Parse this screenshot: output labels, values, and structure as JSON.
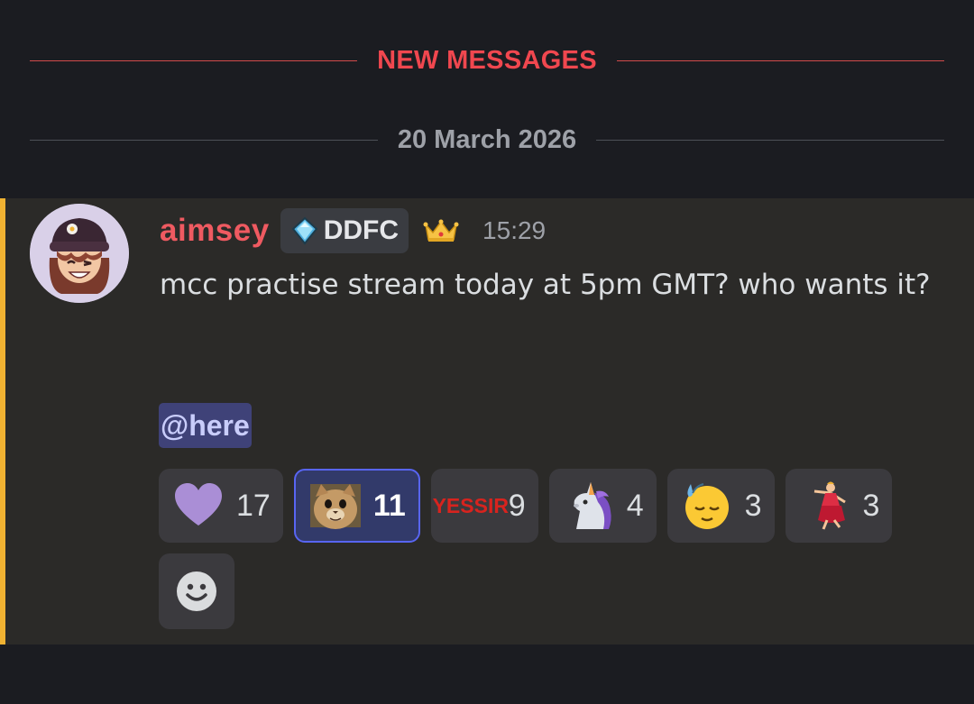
{
  "dividers": {
    "new_messages": "NEW MESSAGES",
    "date": "20 March 2026"
  },
  "message": {
    "username": "aimsey",
    "tag": {
      "icon": "diamond-icon",
      "label": "DDFC"
    },
    "crown_icon": "crown-icon",
    "timestamp": "15:29",
    "text": "mcc practise stream today at 5pm GMT? who wants it?",
    "mention": "@here"
  },
  "reactions": [
    {
      "emoji": "purple-heart-icon",
      "count": "17",
      "selected": false
    },
    {
      "emoji": "cat-face-custom-emoji",
      "count": "11",
      "selected": true
    },
    {
      "emoji": "yes-sir-custom-emoji",
      "text_line1": "YES",
      "text_line2": "SIR",
      "count": "9",
      "selected": false
    },
    {
      "emoji": "unicorn-icon",
      "count": "4",
      "selected": false
    },
    {
      "emoji": "sleepy-sweat-face-icon",
      "count": "3",
      "selected": false
    },
    {
      "emoji": "dancer-icon",
      "count": "3",
      "selected": false
    }
  ],
  "add_reaction_icon": "smiley-add-reaction-icon",
  "colors": {
    "background": "#1b1c21",
    "message_highlight": "#2b2a28",
    "mention_bar": "#f0b232",
    "new_messages": "#f0474f",
    "username": "#ef5a61",
    "selected_reaction_border": "#5865f2"
  }
}
